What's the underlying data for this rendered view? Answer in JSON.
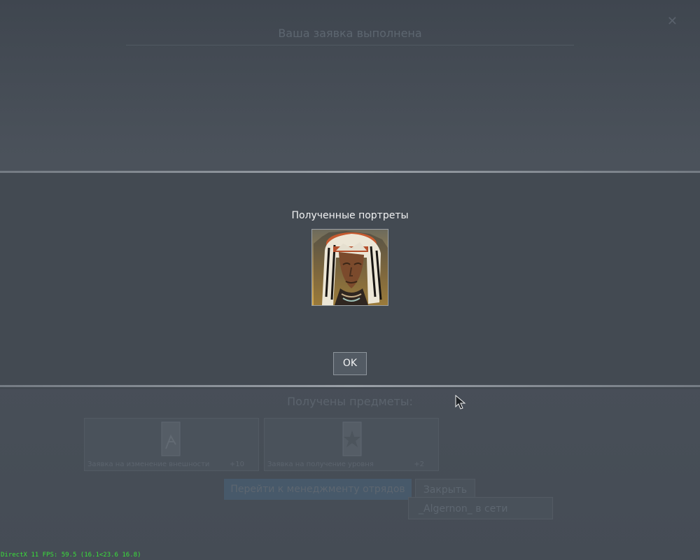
{
  "background": {
    "title": "Ваша заявка выполнена",
    "received_items_title": "Получены предметы:",
    "items": [
      {
        "label": "Заявка на изменение внешности",
        "count": "+10"
      },
      {
        "label": "Заявка на получение уровня",
        "count": "+2"
      }
    ],
    "primary_button": "Перейти к менеджменту отрядов",
    "close_button": "Закрыть",
    "status_text": "_Algernon_ в сети"
  },
  "modal": {
    "heading": "Полученные портреты",
    "ok_label": "OK"
  },
  "fps_text": "DirectX 11 FPS: 59.5 (16.1<23.6 16.8)",
  "colors": {
    "background": "#454c55",
    "modal_band": "#434a52",
    "fps_green": "#39e039",
    "primary_button": "#47596a"
  },
  "icons": [
    "close-icon",
    "portrait-image",
    "item-scroll-icon",
    "item-star-icon",
    "cursor-icon"
  ]
}
